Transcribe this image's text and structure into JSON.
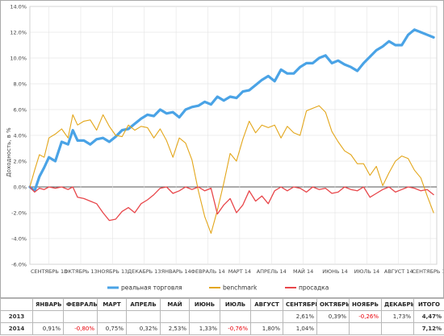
{
  "chart_data": {
    "type": "line",
    "title": "",
    "xlabel": "",
    "ylabel": "Доходность, в %",
    "ylim": [
      -6,
      14
    ],
    "y_ticks": [
      "-6.0%",
      "-4.0%",
      "-2.0%",
      "0.0%",
      "2.0%",
      "4.0%",
      "6.0%",
      "8.0%",
      "10.0%",
      "12.0%",
      "14.0%"
    ],
    "x_ticks": [
      "СЕНТЯБРЬ 13",
      "ОКТЯБРЬ 13",
      "НОЯБРЬ 13",
      "ДЕКАБРЬ 13",
      "ЯНВАРЬ 14",
      "ФЕВРАЛЬ 14",
      "МАРТ 14",
      "АПРЕЛЬ 14",
      "МАЙ 14",
      "ИЮНЬ 14",
      "ИЮЛЬ 14",
      "АВГУСТ 14",
      "СЕНТЯБРЬ 14"
    ],
    "x_range": [
      0,
      12.8
    ],
    "grid": true,
    "legend_position": "bottom",
    "series": [
      {
        "name": "реальная торговля",
        "color": "#4aa3e6",
        "x": [
          0,
          0.15,
          0.3,
          0.45,
          0.6,
          0.8,
          1.0,
          1.2,
          1.35,
          1.5,
          1.7,
          1.9,
          2.1,
          2.3,
          2.5,
          2.7,
          2.9,
          3.1,
          3.3,
          3.5,
          3.7,
          3.9,
          4.1,
          4.3,
          4.5,
          4.7,
          4.9,
          5.1,
          5.3,
          5.5,
          5.7,
          5.9,
          6.1,
          6.3,
          6.5,
          6.7,
          6.9,
          7.1,
          7.3,
          7.5,
          7.7,
          7.9,
          8.1,
          8.3,
          8.5,
          8.7,
          8.9,
          9.1,
          9.3,
          9.5,
          9.7,
          9.9,
          10.1,
          10.3,
          10.5,
          10.7,
          10.9,
          11.1,
          11.3,
          11.5,
          11.7,
          11.9,
          12.1,
          12.3,
          12.5,
          12.7
        ],
        "values": [
          0,
          -0.3,
          0.8,
          1.5,
          2.3,
          2.0,
          3.5,
          3.3,
          4.4,
          3.6,
          3.6,
          3.3,
          3.7,
          3.8,
          3.5,
          3.9,
          4.4,
          4.5,
          4.9,
          5.3,
          5.6,
          5.5,
          6.0,
          5.7,
          5.8,
          5.4,
          6.0,
          6.2,
          6.3,
          6.6,
          6.4,
          7.0,
          6.7,
          7.0,
          6.9,
          7.4,
          7.5,
          7.9,
          8.3,
          8.6,
          8.2,
          9.1,
          8.8,
          8.8,
          9.3,
          9.6,
          9.6,
          10.0,
          10.2,
          9.6,
          9.8,
          9.5,
          9.3,
          9.0,
          9.6,
          10.1,
          10.6,
          10.9,
          11.3,
          11.0,
          11.0,
          11.8,
          12.2,
          12.0,
          11.8,
          11.6
        ]
      },
      {
        "name": "benchmark",
        "color": "#e3a61a",
        "x": [
          0,
          0.15,
          0.3,
          0.45,
          0.6,
          0.8,
          1.0,
          1.2,
          1.35,
          1.5,
          1.7,
          1.9,
          2.1,
          2.3,
          2.5,
          2.7,
          2.9,
          3.1,
          3.3,
          3.5,
          3.7,
          3.9,
          4.1,
          4.3,
          4.5,
          4.7,
          4.9,
          5.1,
          5.3,
          5.5,
          5.7,
          5.9,
          6.1,
          6.3,
          6.5,
          6.7,
          6.9,
          7.1,
          7.3,
          7.5,
          7.7,
          7.9,
          8.1,
          8.3,
          8.5,
          8.7,
          8.9,
          9.1,
          9.3,
          9.5,
          9.7,
          9.9,
          10.1,
          10.3,
          10.5,
          10.7,
          10.9,
          11.1,
          11.3,
          11.5,
          11.7,
          11.9,
          12.1,
          12.3,
          12.5,
          12.7
        ],
        "values": [
          0,
          1.3,
          2.5,
          2.3,
          3.8,
          4.1,
          4.5,
          3.8,
          5.6,
          4.8,
          5.1,
          5.2,
          4.4,
          5.6,
          4.7,
          4.0,
          3.9,
          4.8,
          4.4,
          4.7,
          4.6,
          3.8,
          4.5,
          3.6,
          2.3,
          3.8,
          3.4,
          2.1,
          -0.3,
          -2.3,
          -3.6,
          -1.8,
          0.3,
          2.6,
          2.0,
          3.7,
          5.1,
          4.2,
          4.8,
          4.6,
          4.8,
          3.8,
          4.7,
          4.2,
          4.0,
          5.9,
          6.1,
          6.3,
          5.8,
          4.3,
          3.5,
          2.8,
          2.5,
          1.8,
          1.8,
          0.9,
          1.6,
          0.1,
          1.1,
          2.0,
          2.4,
          2.2,
          1.3,
          0.7,
          -0.7,
          -2.0
        ]
      },
      {
        "name": "просадка",
        "color": "#e8464a",
        "x": [
          0,
          0.15,
          0.3,
          0.45,
          0.6,
          0.8,
          1.0,
          1.2,
          1.35,
          1.5,
          1.7,
          1.9,
          2.1,
          2.3,
          2.5,
          2.7,
          2.9,
          3.1,
          3.3,
          3.5,
          3.7,
          3.9,
          4.1,
          4.3,
          4.5,
          4.7,
          4.9,
          5.1,
          5.3,
          5.5,
          5.7,
          5.9,
          6.1,
          6.3,
          6.5,
          6.7,
          6.9,
          7.1,
          7.3,
          7.5,
          7.7,
          7.9,
          8.1,
          8.3,
          8.5,
          8.7,
          8.9,
          9.1,
          9.3,
          9.5,
          9.7,
          9.9,
          10.1,
          10.3,
          10.5,
          10.7,
          10.9,
          11.1,
          11.3,
          11.5,
          11.7,
          11.9,
          12.1,
          12.3,
          12.5,
          12.7
        ],
        "values": [
          0,
          -0.4,
          -0.1,
          -0.2,
          0,
          -0.1,
          0,
          -0.2,
          0,
          -0.8,
          -0.9,
          -1.1,
          -1.3,
          -2.0,
          -2.6,
          -2.5,
          -1.9,
          -1.6,
          -2.0,
          -1.3,
          -1.0,
          -0.6,
          -0.1,
          0,
          -0.5,
          -0.3,
          0,
          -0.2,
          0,
          -0.3,
          -0.1,
          -2.1,
          -1.4,
          -0.9,
          -2.0,
          -1.4,
          -0.3,
          -1.1,
          -0.7,
          -1.3,
          -0.3,
          0,
          -0.3,
          0,
          -0.1,
          -0.4,
          0,
          -0.2,
          -0.1,
          -0.5,
          -0.4,
          0,
          -0.2,
          -0.3,
          0,
          -0.8,
          -0.5,
          -0.2,
          0,
          -0.4,
          -0.2,
          0,
          -0.1,
          -0.3,
          -0.2,
          -0.6
        ]
      }
    ]
  },
  "table": {
    "headers": [
      "",
      "ЯНВАРЬ",
      "ФЕВРАЛЬ",
      "МАРТ",
      "АПРЕЛЬ",
      "МАЙ",
      "ИЮНЬ",
      "ИЮЛЬ",
      "АВГУСТ",
      "СЕНТЯБРЬ",
      "ОКТЯБРЬ",
      "НОЯБРЬ",
      "ДЕКАБРЬ",
      "ИТОГО"
    ],
    "rows": [
      {
        "year": "2013",
        "cells": [
          "",
          "",
          "",
          "",
          "",
          "",
          "",
          "",
          "2,61%",
          "0,39%",
          "-0,26%",
          "1,73%"
        ],
        "total": "4,47%"
      },
      {
        "year": "2014",
        "cells": [
          "0,91%",
          "-0,80%",
          "0,75%",
          "0,32%",
          "2,53%",
          "1,33%",
          "-0,76%",
          "1,80%",
          "1,04%",
          "",
          "",
          ""
        ],
        "total": "7,12%"
      }
    ]
  }
}
